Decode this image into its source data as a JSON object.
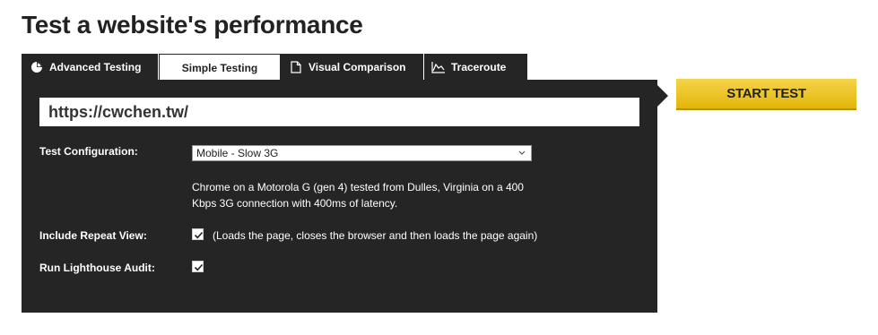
{
  "page": {
    "title": "Test a website's performance"
  },
  "tabs": [
    {
      "label": "Advanced Testing",
      "icon": "pie-chart-icon",
      "active": false
    },
    {
      "label": "Simple Testing",
      "active": true
    },
    {
      "label": "Visual Comparison",
      "icon": "document-icon",
      "active": false
    },
    {
      "label": "Traceroute",
      "icon": "traceroute-icon",
      "active": false
    }
  ],
  "form": {
    "url_value": "https://cwchen.tw/",
    "config_label": "Test Configuration:",
    "config_selected": "Mobile - Slow 3G",
    "config_description": "Chrome on a Motorola G (gen 4) tested from Dulles, Virginia on a 400 Kbps 3G connection with 400ms of latency.",
    "repeat_view_label": "Include Repeat View:",
    "repeat_view_checked": true,
    "repeat_view_note": "(Loads the page, closes the browser and then loads the page again)",
    "lighthouse_label": "Run Lighthouse Audit:",
    "lighthouse_checked": true
  },
  "actions": {
    "start_label": "START TEST"
  },
  "colors": {
    "panel": "#252525",
    "accent": "#f0c419",
    "text_light": "#ffffff"
  }
}
